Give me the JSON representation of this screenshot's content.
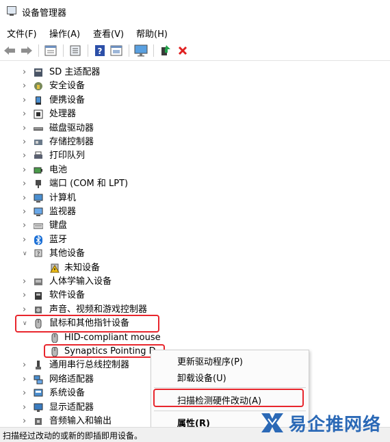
{
  "window": {
    "title": "设备管理器"
  },
  "menu": [
    "文件(F)",
    "操作(A)",
    "查看(V)",
    "帮助(H)"
  ],
  "toolbar": [
    "back-icon",
    "forward-icon",
    "properties-icon",
    "show-hidden-icon",
    "help-icon",
    "view-icon",
    "monitor-icon",
    "update-driver-icon",
    "uninstall-icon"
  ],
  "tree": [
    {
      "label": "SD 主适配器",
      "icon": "sd-card-icon",
      "state": "collapsed"
    },
    {
      "label": "安全设备",
      "icon": "security-key-icon",
      "state": "collapsed"
    },
    {
      "label": "便携设备",
      "icon": "portable-device-icon",
      "state": "collapsed"
    },
    {
      "label": "处理器",
      "icon": "processor-icon",
      "state": "collapsed"
    },
    {
      "label": "磁盘驱动器",
      "icon": "disk-drive-icon",
      "state": "collapsed"
    },
    {
      "label": "存储控制器",
      "icon": "storage-controller-icon",
      "state": "collapsed"
    },
    {
      "label": "打印队列",
      "icon": "printer-icon",
      "state": "collapsed"
    },
    {
      "label": "电池",
      "icon": "battery-icon",
      "state": "collapsed"
    },
    {
      "label": "端口 (COM 和 LPT)",
      "icon": "port-icon",
      "state": "collapsed"
    },
    {
      "label": "计算机",
      "icon": "computer-icon",
      "state": "collapsed"
    },
    {
      "label": "监视器",
      "icon": "monitor-icon",
      "state": "collapsed"
    },
    {
      "label": "键盘",
      "icon": "keyboard-icon",
      "state": "collapsed"
    },
    {
      "label": "蓝牙",
      "icon": "bluetooth-icon",
      "state": "collapsed"
    },
    {
      "label": "其他设备",
      "icon": "unknown-devices-icon",
      "state": "expanded"
    },
    {
      "label": "未知设备",
      "icon": "warning-device-icon",
      "state": "child"
    },
    {
      "label": "人体学输入设备",
      "icon": "hid-icon",
      "state": "collapsed"
    },
    {
      "label": "软件设备",
      "icon": "software-device-icon",
      "state": "collapsed"
    },
    {
      "label": "声音、视频和游戏控制器",
      "icon": "sound-icon",
      "state": "collapsed"
    },
    {
      "label": "鼠标和其他指针设备",
      "icon": "mouse-icon",
      "state": "expanded"
    },
    {
      "label": "HID-compliant mouse",
      "icon": "mouse-icon",
      "state": "child"
    },
    {
      "label": "Synaptics Pointing D",
      "icon": "mouse-icon",
      "state": "child"
    },
    {
      "label": "通用串行总线控制器",
      "icon": "usb-icon",
      "state": "collapsed"
    },
    {
      "label": "网络适配器",
      "icon": "network-icon",
      "state": "collapsed"
    },
    {
      "label": "系统设备",
      "icon": "system-device-icon",
      "state": "collapsed"
    },
    {
      "label": "显示适配器",
      "icon": "display-adapter-icon",
      "state": "collapsed"
    },
    {
      "label": "音频输入和输出",
      "icon": "audio-icon",
      "state": "collapsed"
    }
  ],
  "context_menu": {
    "update_driver": "更新驱动程序(P)",
    "uninstall": "卸载设备(U)",
    "scan": "扫描检测硬件改动(A)",
    "properties": "属性(R)"
  },
  "status": "扫描经过改动的或新的即插即用设备。",
  "watermark": "易企推网络",
  "colors": {
    "highlight_box": "#e8252c",
    "watermark": "#2b69b6",
    "uninstall_x": "#e02020"
  }
}
